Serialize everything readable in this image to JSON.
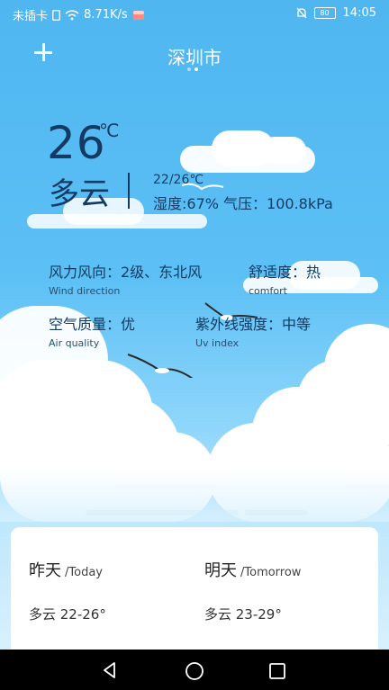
{
  "status_bar": {
    "carrier": "未插卡",
    "speed": "8.71K/s",
    "battery": "80",
    "time": "14:05"
  },
  "header": {
    "city": "深圳市",
    "page_dots": 2,
    "active_dot": 1
  },
  "current": {
    "temperature": "26",
    "unit": "℃",
    "condition": "多云",
    "range": "22/26℃",
    "humidity_pressure": "湿度:67%  气压：100.8kPa"
  },
  "details": {
    "wind": {
      "label": "风力风向：2级、东北风",
      "sub": "Wind direction"
    },
    "comfort": {
      "label": "舒适度：热",
      "sub": "comfort"
    },
    "air": {
      "label": "空气质量：优",
      "sub": "Air quality"
    },
    "uv": {
      "label": "紫外线强度：中等",
      "sub": "Uv index"
    }
  },
  "forecast": {
    "today": {
      "day": "昨天",
      "en": "/Today",
      "summary": "多云 22-26°"
    },
    "tomorrow": {
      "day": "明天",
      "en": "/Tomorrow",
      "summary": "多云 23-29°"
    }
  },
  "icons": [
    "plus-icon",
    "back-icon",
    "home-icon",
    "recents-icon",
    "wifi-icon",
    "mute-icon"
  ]
}
